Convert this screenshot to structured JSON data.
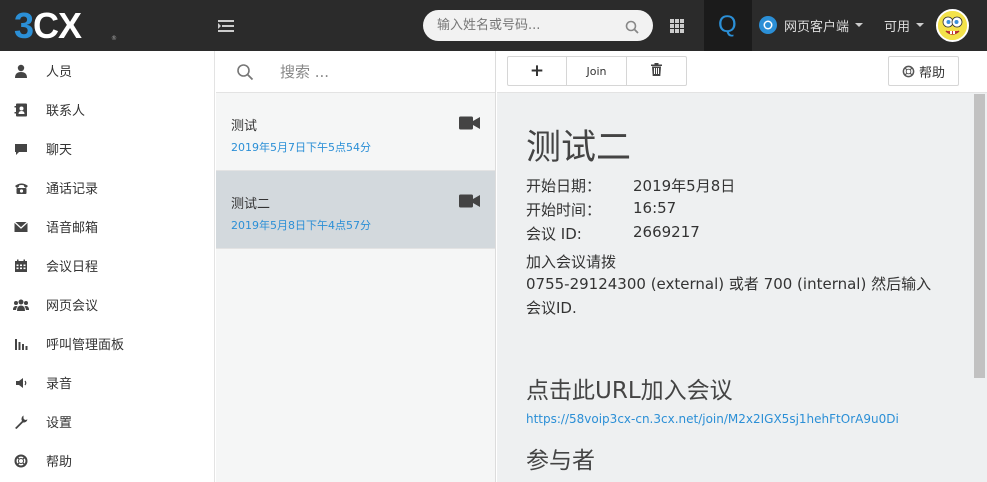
{
  "app": {
    "logo": {
      "three": "3",
      "cx": "CX",
      "reg": "®"
    }
  },
  "topbar": {
    "search_placeholder": "输入姓名或号码...",
    "q_letter": "Q",
    "client_label": "网页客户端",
    "status_label": "可用"
  },
  "sidebar": {
    "items": [
      {
        "label": "人员",
        "icon": "person-icon"
      },
      {
        "label": "联系人",
        "icon": "contacts-icon"
      },
      {
        "label": "聊天",
        "icon": "chat-icon"
      },
      {
        "label": "通话记录",
        "icon": "phone-icon"
      },
      {
        "label": "语音邮箱",
        "icon": "envelope-icon"
      },
      {
        "label": "会议日程",
        "icon": "calendar-icon"
      },
      {
        "label": "网页会议",
        "icon": "users-icon"
      },
      {
        "label": "呼叫管理面板",
        "icon": "bar-chart-icon"
      },
      {
        "label": "录音",
        "icon": "speaker-icon"
      },
      {
        "label": "设置",
        "icon": "wrench-icon"
      },
      {
        "label": "帮助",
        "icon": "lifebuoy-icon"
      }
    ]
  },
  "meetings": {
    "search_placeholder": "搜索 ...",
    "items": [
      {
        "name": "测试",
        "time": "2019年5月7日下午5点54分"
      },
      {
        "name": "测试二",
        "time": "2019年5月8日下午4点57分"
      }
    ]
  },
  "toolbar": {
    "add_label": "+",
    "join_label": "Join",
    "help_label": "帮助"
  },
  "detail": {
    "title": "测试二",
    "start_date_label": "开始日期：",
    "start_date_value": "2019年5月8日",
    "start_time_label": "开始时间：",
    "start_time_value": "16:57",
    "meeting_id_label": "会议 ID:",
    "meeting_id_value": "2669217",
    "dial_in_heading": "加入会议请拨",
    "dial_in_text": "0755-29124300 (external) 或者 700 (internal) 然后输入会议ID.",
    "url_heading": "点击此URL加入会议",
    "url": "https://58voip3cx-cn.3cx.net/join/M2x2IGX5sj1hehFtOrA9u0Di",
    "participants_heading": "参与者"
  },
  "colors": {
    "brand_blue": "#2b8fd6",
    "topbar_bg": "#2b2b2b",
    "selected_row": "#d3d9dd"
  }
}
